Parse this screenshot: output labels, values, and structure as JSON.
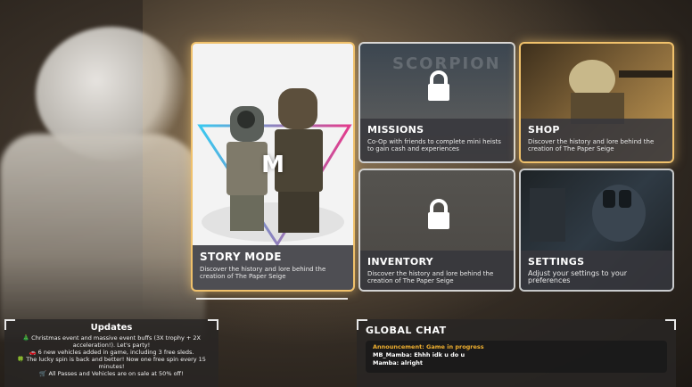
{
  "menu": {
    "story_mode": {
      "title": "STORY MODE",
      "description": "Discover the history and lore behind the creation of The Paper Seige",
      "logo_letter": "M"
    },
    "missions": {
      "title": "MISSIONS",
      "description": "Co-Op with friends to complete mini heists to gain cash and experiences",
      "locked": true,
      "bg_text": "SCORPION"
    },
    "shop": {
      "title": "SHOP",
      "description": "Discover the history and lore behind the creation of The Paper Seige"
    },
    "inventory": {
      "title": "INVENTORY",
      "description": "Discover the history and lore behind the creation of The Paper Seige",
      "locked": true
    },
    "settings": {
      "title": "SETTINGS",
      "description": "Adjust your settings to your preferences"
    }
  },
  "updates": {
    "title": "Updates",
    "items": [
      "🎄 Christmas event and massive event buffs (3X trophy + 2X acceleration!). Let's party!",
      "🚗 6 new vehicles added in game, including 3 free sleds.",
      "🍀 The lucky spin is back and better! Now one free spin every 15 minutes!",
      "🛒 All Passes and Vehicles are on sale at 50% off!"
    ]
  },
  "global_chat": {
    "title": "GLOBAL CHAT",
    "messages": [
      {
        "text": "Announcement: Game in progress",
        "type": "announcement"
      },
      {
        "text": "MB_Mamba: Ehhh idk u do u",
        "type": "user"
      },
      {
        "text": "Mamba: alright",
        "type": "user"
      }
    ]
  },
  "colors": {
    "accent_gold": "#f0c16b",
    "announcement": "#f0b02f",
    "logo_gradient_start": "#39c9f0",
    "logo_gradient_end": "#e33b8c"
  }
}
